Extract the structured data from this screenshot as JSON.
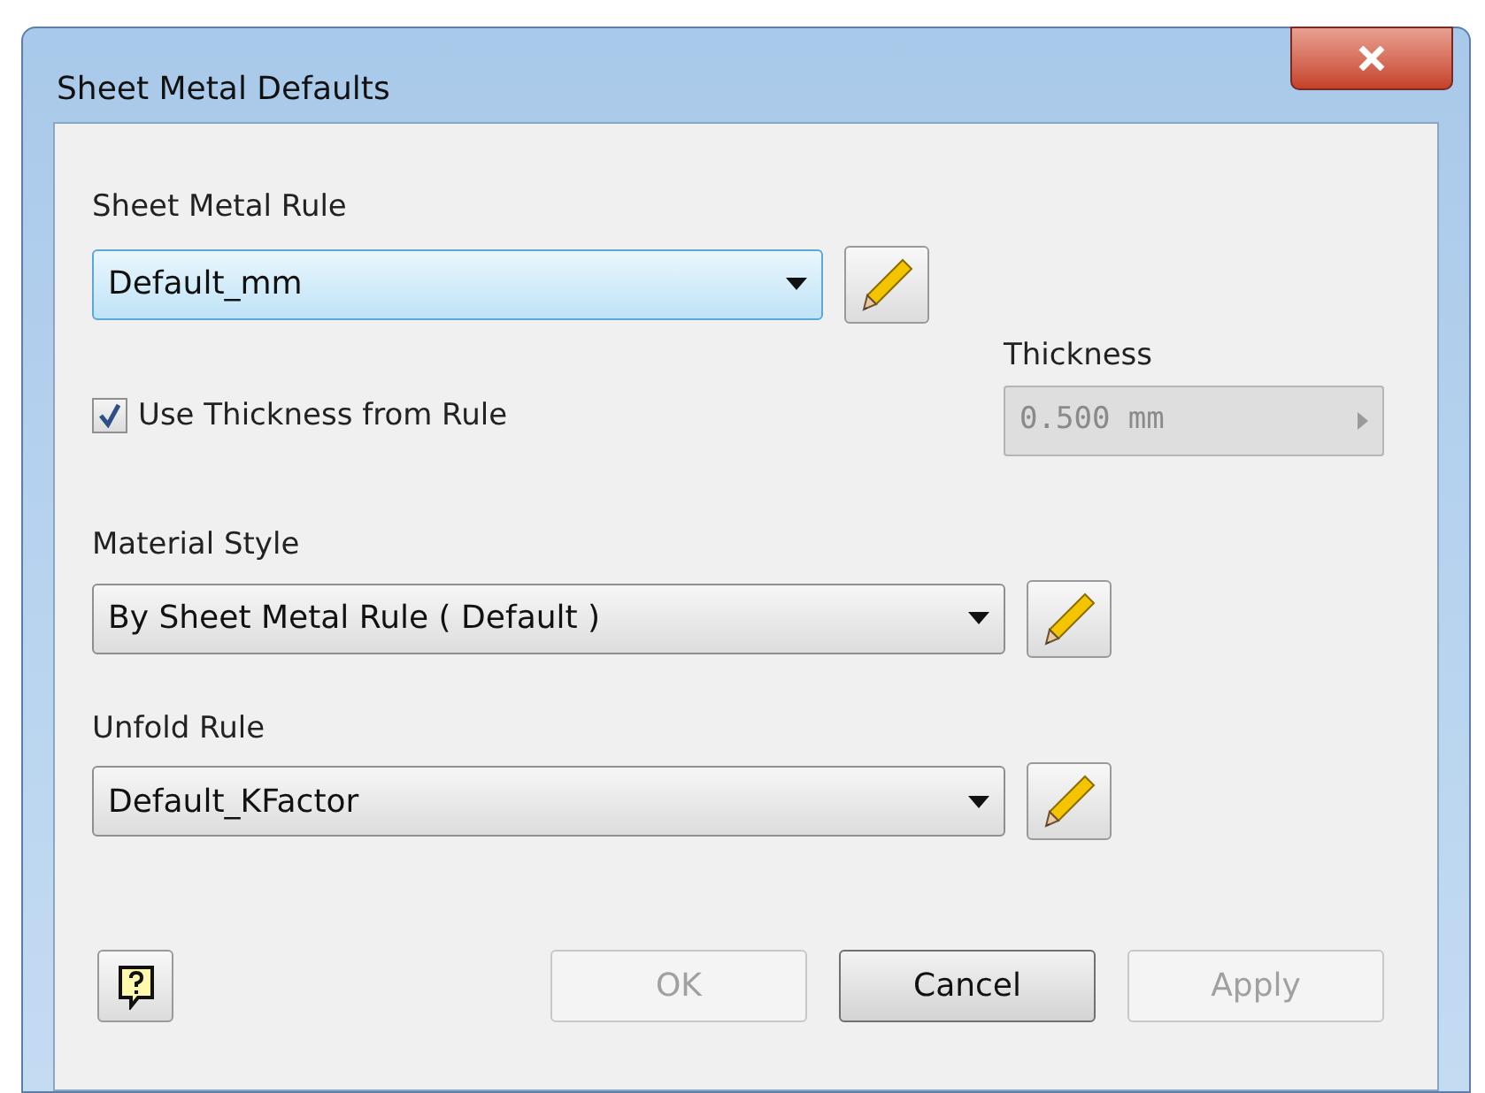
{
  "window": {
    "title": "Sheet Metal Defaults"
  },
  "sheet_metal_rule": {
    "label": "Sheet Metal Rule",
    "value": "Default_mm",
    "focused": true
  },
  "use_thickness": {
    "label": "Use Thickness from Rule",
    "checked": true
  },
  "thickness": {
    "label": "Thickness",
    "value": "0.500 mm",
    "disabled": true
  },
  "material_style": {
    "label": "Material Style",
    "value": "By Sheet Metal Rule ( Default )",
    "focused": false
  },
  "unfold_rule": {
    "label": "Unfold Rule",
    "value": "Default_KFactor",
    "focused": false
  },
  "buttons": [
    {
      "label": "OK",
      "disabled": true
    },
    {
      "label": "Cancel",
      "disabled": false
    },
    {
      "label": "Apply",
      "disabled": true
    }
  ]
}
